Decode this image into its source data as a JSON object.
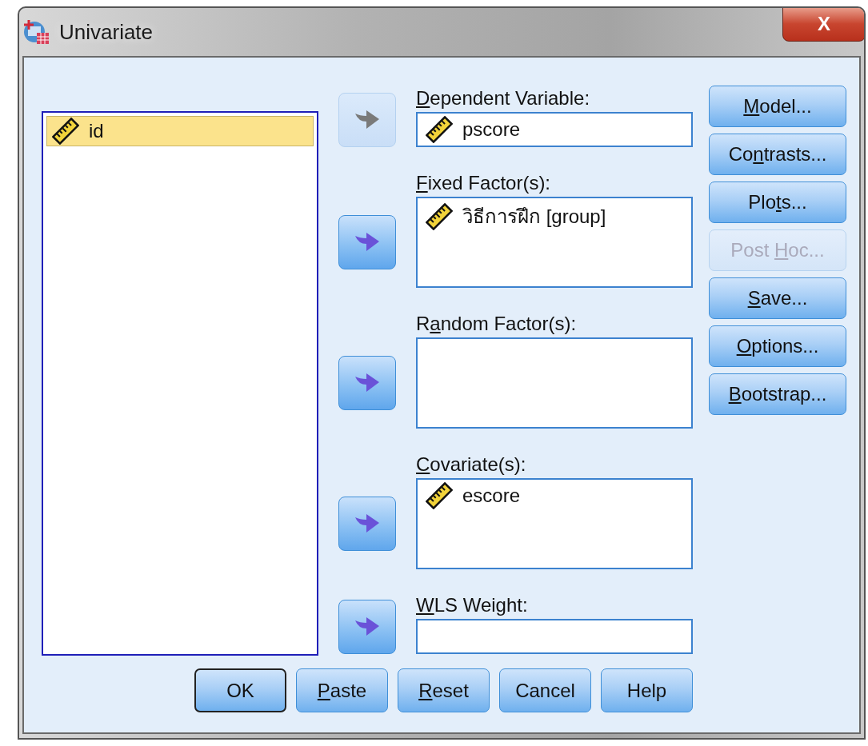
{
  "window": {
    "title": "Univariate",
    "close_label": "X"
  },
  "source_variables": [
    {
      "name": "id",
      "selected": true
    }
  ],
  "targets": [
    {
      "label": {
        "key": "D",
        "after": "ependent Variable:"
      },
      "kind": "field",
      "arrow_disabled": true,
      "items": [
        {
          "name": "pscore"
        }
      ]
    },
    {
      "label": {
        "key": "F",
        "after": "ixed Factor(s):"
      },
      "kind": "list",
      "arrow_disabled": false,
      "items": [
        {
          "name": "วิธีการฝึก [group]"
        }
      ]
    },
    {
      "label": {
        "before": "R",
        "key": "a",
        "after": "ndom Factor(s):"
      },
      "kind": "list",
      "arrow_disabled": false
    },
    {
      "label": {
        "key": "C",
        "after": "ovariate(s):"
      },
      "kind": "list",
      "arrow_disabled": false,
      "items": [
        {
          "name": "escore"
        }
      ]
    },
    {
      "label": {
        "key": "W",
        "after": "LS Weight:"
      },
      "kind": "field",
      "arrow_disabled": false
    }
  ],
  "side_buttons": [
    {
      "label": {
        "key": "M",
        "after": "odel..."
      },
      "disabled": false
    },
    {
      "label": {
        "before": "Co",
        "key": "n",
        "after": "trasts..."
      },
      "disabled": false
    },
    {
      "label": {
        "before": "Plo",
        "key": "t",
        "after": "s..."
      },
      "disabled": false
    },
    {
      "label": {
        "before": "Post ",
        "key": "H",
        "after": "oc..."
      },
      "disabled": true
    },
    {
      "label": {
        "key": "S",
        "after": "ave..."
      },
      "disabled": false
    },
    {
      "label": {
        "key": "O",
        "after": "ptions..."
      },
      "disabled": false
    },
    {
      "label": {
        "key": "B",
        "after": "ootstrap..."
      },
      "disabled": false
    }
  ],
  "bottom_buttons": [
    {
      "label": {
        "before": "OK"
      },
      "default": true
    },
    {
      "label": {
        "key": "P",
        "after": "aste"
      },
      "default": false
    },
    {
      "label": {
        "key": "R",
        "after": "eset"
      },
      "default": false
    },
    {
      "label": {
        "before": "Cancel"
      },
      "default": false
    },
    {
      "label": {
        "before": "Help"
      },
      "default": false
    }
  ]
}
